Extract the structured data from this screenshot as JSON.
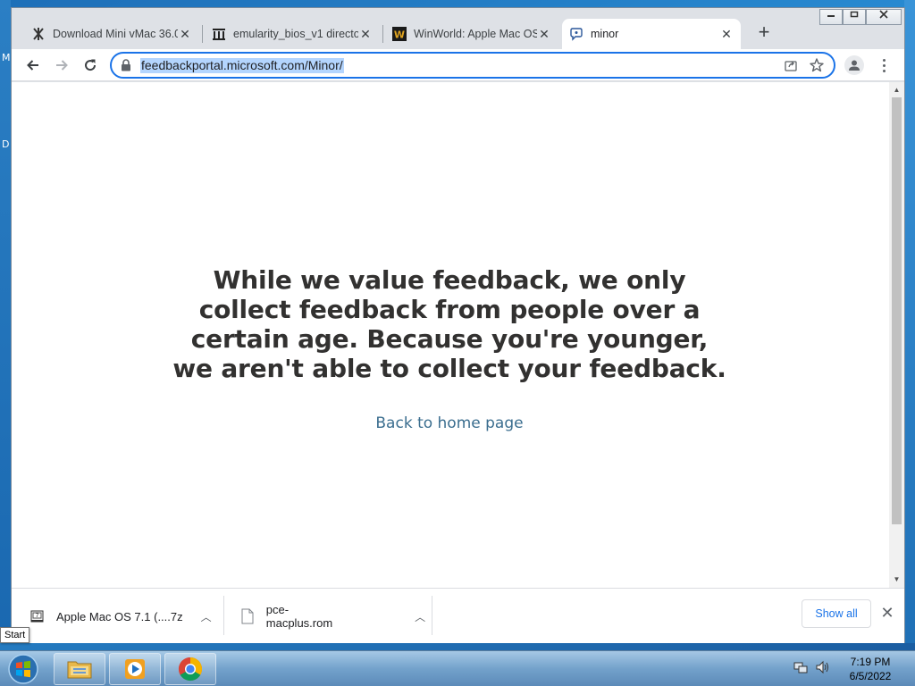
{
  "desktop": {
    "edge_letters": [
      "M",
      "D"
    ]
  },
  "window": {
    "controls": [
      "minimize",
      "maximize",
      "close"
    ]
  },
  "tabs": [
    {
      "title": "Download Mini vMac 36.0",
      "icon": "minivmac-icon",
      "close": "✕"
    },
    {
      "title": "emularity_bios_v1 directo",
      "icon": "archive-org-icon",
      "close": "✕"
    },
    {
      "title": "WinWorld: Apple Mac OS",
      "icon": "winworld-icon",
      "close": "✕"
    },
    {
      "title": "minor",
      "icon": "feedback-icon",
      "close": "✕",
      "active": true
    }
  ],
  "new_tab_label": "+",
  "toolbar": {
    "url": "feedbackportal.microsoft.com/Minor/"
  },
  "page": {
    "message": "While we value feedback, we only collect feedback from people over a certain age. Because you're younger, we aren't able to collect your feedback.",
    "home_link": "Back to home page",
    "colors": {
      "text": "#323130",
      "link": "#3b6e8f"
    }
  },
  "downloads": {
    "items": [
      {
        "name": "Apple Mac OS 7.1 (....7z",
        "icon": "archive-file-icon"
      },
      {
        "name": "pce-macplus.rom",
        "icon": "file-icon"
      }
    ],
    "show_all": "Show all",
    "close": "✕"
  },
  "tooltip": "Start",
  "taskbar": {
    "apps": [
      "windows-explorer",
      "media-player",
      "chrome"
    ],
    "time": "7:19 PM",
    "date": "6/5/2022"
  }
}
